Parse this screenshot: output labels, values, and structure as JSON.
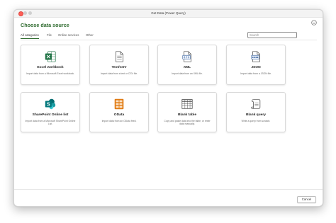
{
  "window": {
    "title": "Get Data (Power Query)"
  },
  "header": {
    "title": "Choose data source"
  },
  "tabs": [
    {
      "label": "All categories"
    },
    {
      "label": "File"
    },
    {
      "label": "Online services"
    },
    {
      "label": "Other"
    }
  ],
  "search": {
    "placeholder": "Search",
    "value": ""
  },
  "cards": [
    {
      "title": "Excel workbook",
      "description": "Import data from a Microsoft Excel workbook.",
      "icon": "excel-icon"
    },
    {
      "title": "Text/CSV",
      "description": "Import data from a text or CSV file.",
      "icon": "text-file-icon"
    },
    {
      "title": "XML",
      "description": "Import data from an XML file.",
      "icon": "xml-file-icon"
    },
    {
      "title": "JSON",
      "description": "Import data from a JSON file.",
      "icon": "json-file-icon"
    },
    {
      "title": "SharePoint Online list",
      "description": "Import data from a Microsoft SharePoint Online List.",
      "icon": "sharepoint-icon"
    },
    {
      "title": "OData",
      "description": "Import data from an OData feed.",
      "icon": "odata-icon"
    },
    {
      "title": "Blank table",
      "description": "Copy and paste data into the table, or enter data manually.",
      "icon": "table-icon"
    },
    {
      "title": "Blank query",
      "description": "Write a query from scratch.",
      "icon": "scroll-icon"
    }
  ],
  "footer": {
    "cancel_label": "Cancel"
  },
  "colors": {
    "accent": "#2f6b2f",
    "excel": "#1f7244",
    "sharepoint": "#0b7f7a",
    "odata": "#e07b14"
  }
}
